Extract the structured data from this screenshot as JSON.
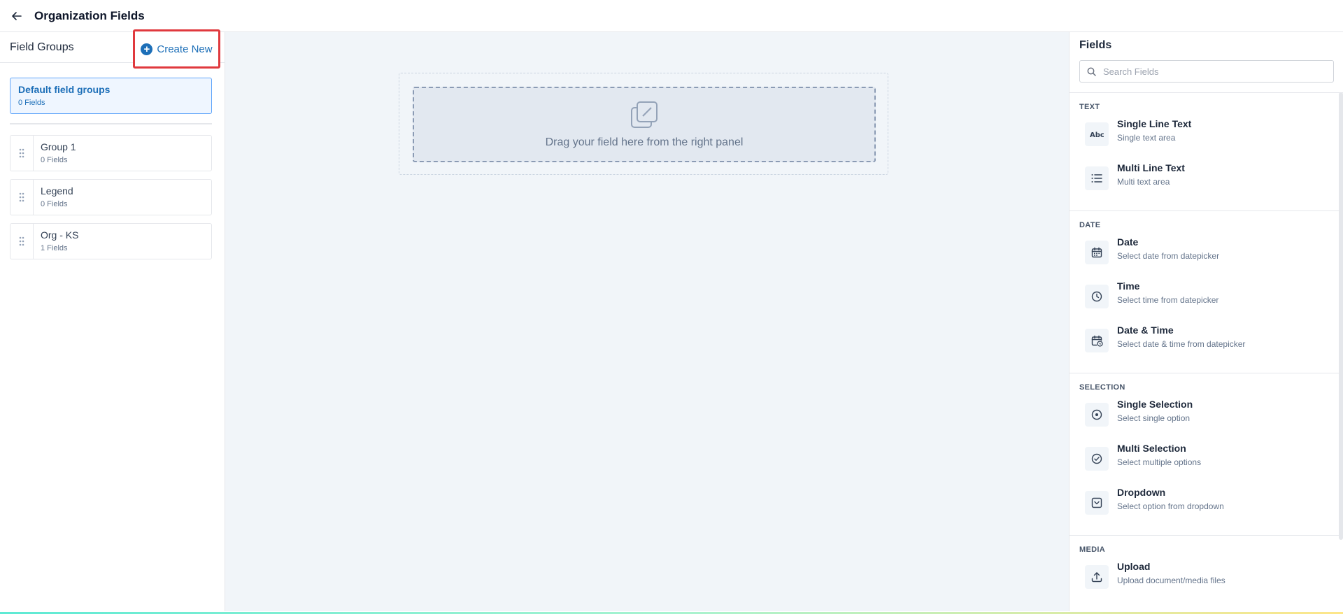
{
  "header": {
    "title": "Organization Fields"
  },
  "left_panel": {
    "title": "Field Groups",
    "create_new_label": "Create New",
    "default_group": {
      "title": "Default field groups",
      "count": "0 Fields"
    },
    "groups": [
      {
        "title": "Group 1",
        "count": "0 Fields"
      },
      {
        "title": "Legend",
        "count": "0 Fields"
      },
      {
        "title": "Org - KS",
        "count": "1 Fields"
      }
    ]
  },
  "canvas": {
    "drop_text": "Drag your field here from the right panel"
  },
  "right_panel": {
    "title": "Fields",
    "search_placeholder": "Search Fields",
    "sections": [
      {
        "label": "TEXT",
        "items": [
          {
            "name": "Single Line Text",
            "desc": "Single text area",
            "icon": "abc-icon"
          },
          {
            "name": "Multi Line Text",
            "desc": "Multi text area",
            "icon": "list-icon"
          }
        ]
      },
      {
        "label": "DATE",
        "items": [
          {
            "name": "Date",
            "desc": "Select date from datepicker",
            "icon": "calendar-icon"
          },
          {
            "name": "Time",
            "desc": "Select time from datepicker",
            "icon": "clock-icon"
          },
          {
            "name": "Date & Time",
            "desc": "Select date & time from datepicker",
            "icon": "calendar-clock-icon"
          }
        ]
      },
      {
        "label": "SELECTION",
        "items": [
          {
            "name": "Single Selection",
            "desc": "Select single option",
            "icon": "radio-icon"
          },
          {
            "name": "Multi Selection",
            "desc": "Select multiple options",
            "icon": "check-circle-icon"
          },
          {
            "name": "Dropdown",
            "desc": "Select option from dropdown",
            "icon": "dropdown-icon"
          }
        ]
      },
      {
        "label": "MEDIA",
        "items": [
          {
            "name": "Upload",
            "desc": "Upload document/media files",
            "icon": "upload-icon"
          }
        ]
      }
    ]
  },
  "colors": {
    "accent": "#1d6fb8",
    "highlight_border": "#e0393e"
  }
}
